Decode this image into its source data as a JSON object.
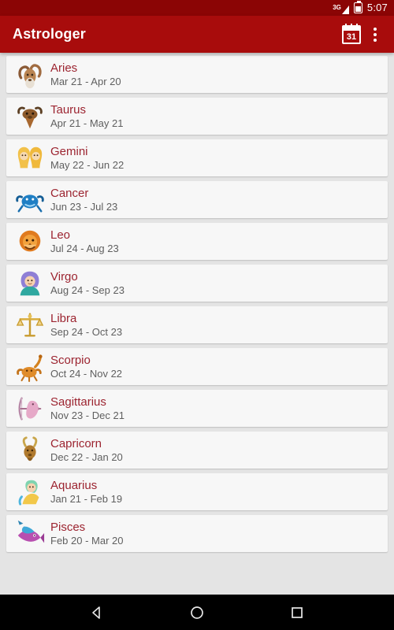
{
  "status_bar": {
    "network_label": "3G",
    "signal_icon": "signal-bars-icon",
    "battery_icon": "battery-icon",
    "time": "5:07"
  },
  "app_bar": {
    "title": "Astrologer",
    "calendar_icon": "calendar-icon",
    "calendar_day": "31",
    "overflow_icon": "overflow-menu-icon"
  },
  "colors": {
    "status_bar": "#8b0505",
    "app_bar": "#a80c0c",
    "page_background": "#e4e4e4",
    "card_background": "#f7f7f7",
    "sign_name": "#9c2430",
    "sign_dates": "#5f5f5f",
    "nav_bar": "#000000"
  },
  "list": {
    "items": [
      {
        "name": "Aries",
        "dates": "Mar 21 - Apr 20",
        "icon": "aries-ram-icon"
      },
      {
        "name": "Taurus",
        "dates": "Apr 21 - May 21",
        "icon": "taurus-bull-icon"
      },
      {
        "name": "Gemini",
        "dates": "May 22 - Jun 22",
        "icon": "gemini-twins-icon"
      },
      {
        "name": "Cancer",
        "dates": "Jun 23 - Jul 23",
        "icon": "cancer-crab-icon"
      },
      {
        "name": "Leo",
        "dates": "Jul 24 - Aug 23",
        "icon": "leo-lion-icon"
      },
      {
        "name": "Virgo",
        "dates": "Aug 24 - Sep 23",
        "icon": "virgo-maiden-icon"
      },
      {
        "name": "Libra",
        "dates": "Sep 24 - Oct 23",
        "icon": "libra-scales-icon"
      },
      {
        "name": "Scorpio",
        "dates": "Oct 24 - Nov 22",
        "icon": "scorpio-scorpion-icon"
      },
      {
        "name": "Sagittarius",
        "dates": "Nov 23 - Dec 21",
        "icon": "sagittarius-archer-icon"
      },
      {
        "name": "Capricorn",
        "dates": "Dec 22 - Jan 20",
        "icon": "capricorn-goat-icon"
      },
      {
        "name": "Aquarius",
        "dates": "Jan 21 - Feb 19",
        "icon": "aquarius-waterbearer-icon"
      },
      {
        "name": "Pisces",
        "dates": "Feb 20 - Mar 20",
        "icon": "pisces-fish-icon"
      }
    ]
  },
  "nav_bar": {
    "back_icon": "back-triangle-icon",
    "home_icon": "home-circle-icon",
    "recents_icon": "recents-square-icon"
  }
}
